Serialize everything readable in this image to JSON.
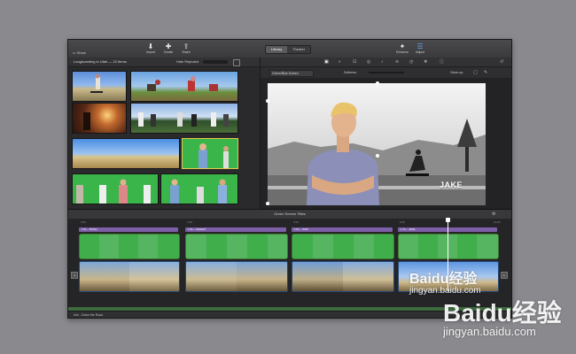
{
  "toolbar": {
    "show_label": "Show",
    "import_label": "Import",
    "create_label": "Create",
    "share_label": "Share",
    "tabs": [
      {
        "label": "Library",
        "active": true
      },
      {
        "label": "Theater",
        "active": false
      }
    ],
    "enhance_label": "Enhance",
    "adjust_label": "Adjust"
  },
  "library": {
    "title": "Longboarding in Utah — 22 Items",
    "hide_label": "Hide Rejected"
  },
  "viewer": {
    "effect_dropdown": "Green/Blue Screen",
    "softness_label": "Softness:",
    "cleanup_label": "Clean-up:",
    "overlay_name": "JAKE"
  },
  "timeline": {
    "title": "Green Screen Titles",
    "time_marks": [
      "0:00",
      "3:00",
      "6:00",
      "9:00",
      "12:00"
    ],
    "title_clips": [
      "1.6s – NOAH",
      "1.6s – ASHLEY",
      "1.6s – SAM",
      "1.7s – JAKE"
    ],
    "status_text": "Info - Down the Road"
  },
  "watermark": {
    "small_text": "Baidu经验",
    "small_url": "jingyan.baidu.com",
    "big_text": "Baidu经验",
    "big_url": "jingyan.baidu.com"
  },
  "colors": {
    "title_bar": "#7d5fa8",
    "green_track": "#6aa84f",
    "primary_track": "#3b6aa0",
    "selection": "#e8c84a"
  }
}
